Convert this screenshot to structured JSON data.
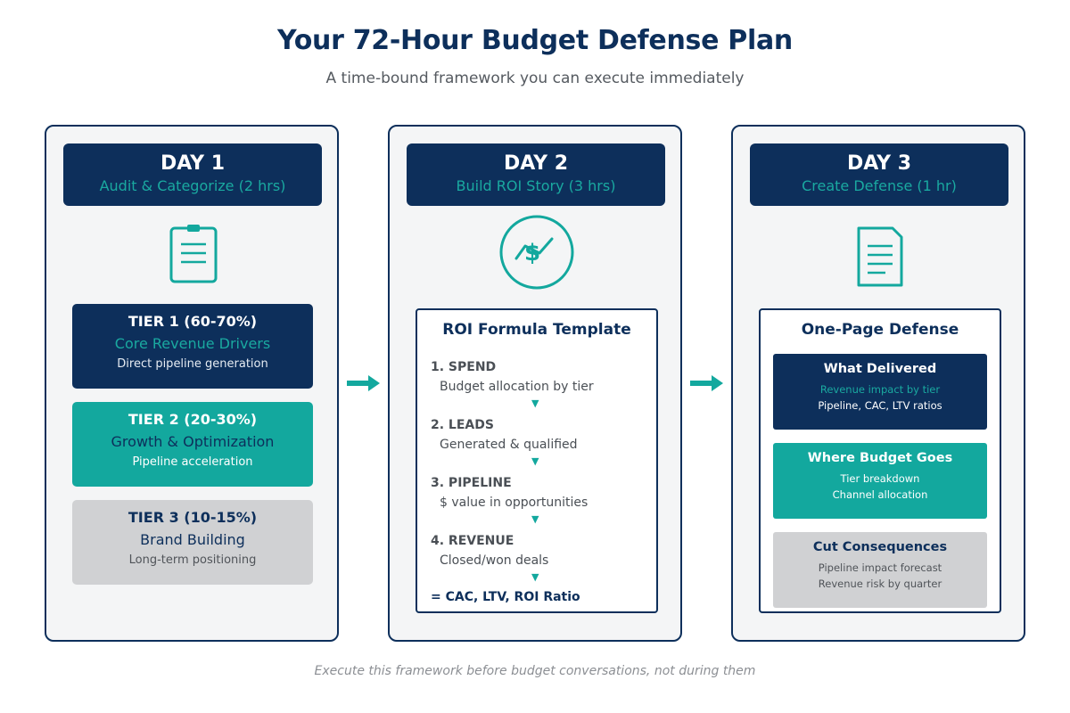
{
  "header": {
    "title": "Your 72-Hour Budget Defense Plan",
    "subtitle": "A time-bound framework you can execute immediately"
  },
  "colors": {
    "navy": "#0d2f5b",
    "teal": "#13a89e",
    "gray": "#d0d1d3",
    "panel_bg": "#f4f5f6"
  },
  "days": [
    {
      "title": "DAY 1",
      "subtitle": "Audit & Categorize (2 hrs)",
      "icon": "clipboard-icon",
      "tiers": [
        {
          "title": "TIER 1 (60-70%)",
          "name": "Core Revenue Drivers",
          "description": "Direct pipeline generation"
        },
        {
          "title": "TIER 2 (20-30%)",
          "name": "Growth & Optimization",
          "description": "Pipeline acceleration"
        },
        {
          "title": "TIER 3 (10-15%)",
          "name": "Brand Building",
          "description": "Long-term positioning"
        }
      ]
    },
    {
      "title": "DAY 2",
      "subtitle": "Build ROI Story (3 hrs)",
      "icon": "dollar-trend-icon",
      "panel": {
        "title": "ROI Formula Template",
        "steps": [
          {
            "label": "1. SPEND",
            "description": "Budget allocation by tier"
          },
          {
            "label": "2. LEADS",
            "description": "Generated & qualified"
          },
          {
            "label": "3. PIPELINE",
            "description": "$ value in opportunities"
          },
          {
            "label": "4. REVENUE",
            "description": "Closed/won deals"
          }
        ],
        "result": "= CAC, LTV, ROI Ratio"
      }
    },
    {
      "title": "DAY 3",
      "subtitle": "Create Defense (1 hr)",
      "icon": "document-icon",
      "panel": {
        "title": "One-Page Defense",
        "boxes": [
          {
            "title": "What Delivered",
            "line1": "Revenue impact by tier",
            "line2": "Pipeline, CAC, LTV ratios"
          },
          {
            "title": "Where Budget Goes",
            "line1": "Tier breakdown",
            "line2": "Channel allocation"
          },
          {
            "title": "Cut Consequences",
            "line1": "Pipeline impact forecast",
            "line2": "Revenue risk by quarter"
          }
        ]
      }
    }
  ],
  "footer": "Execute this framework before budget conversations, not during them"
}
